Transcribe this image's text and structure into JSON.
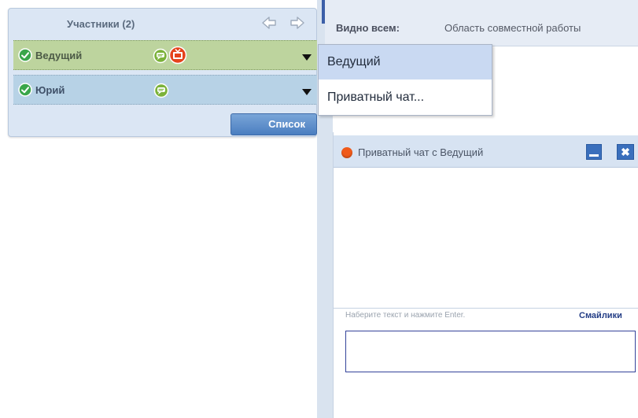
{
  "participants_panel": {
    "title": "Участники (2)",
    "nav": {
      "back_icon": "arrow-left-icon",
      "forward_icon": "arrow-right-icon"
    },
    "participants": [
      {
        "name": "Ведущий",
        "status_icon": "check-circle-icon",
        "chat_icon": "chat-bubble-icon",
        "extra_icon": "tv-icon",
        "row_color": "#bdd49e"
      },
      {
        "name": "Юрий",
        "status_icon": "check-circle-icon",
        "chat_icon": "chat-bubble-icon",
        "row_color": "#b7d2e6"
      }
    ],
    "list_button": "Список"
  },
  "top_bar": {
    "visibility_label": "Видно всем:",
    "workspace_label": "Область совместной работы"
  },
  "context_menu": {
    "items": [
      {
        "label": "Ведущий",
        "highlighted": true
      },
      {
        "label": "Приватный чат...",
        "highlighted": false
      }
    ]
  },
  "private_chat": {
    "title": "Приватный чат с Ведущий",
    "status_color": "#f05a1a",
    "input_hint": "Наберите текст и нажмите Enter.",
    "smileys_link": "Смайлики",
    "input_value": ""
  },
  "colors": {
    "accent": "#3a6fbc",
    "panel_bg": "#dbe6f4",
    "host_row": "#bdd49e",
    "user_row": "#b7d2e6"
  }
}
